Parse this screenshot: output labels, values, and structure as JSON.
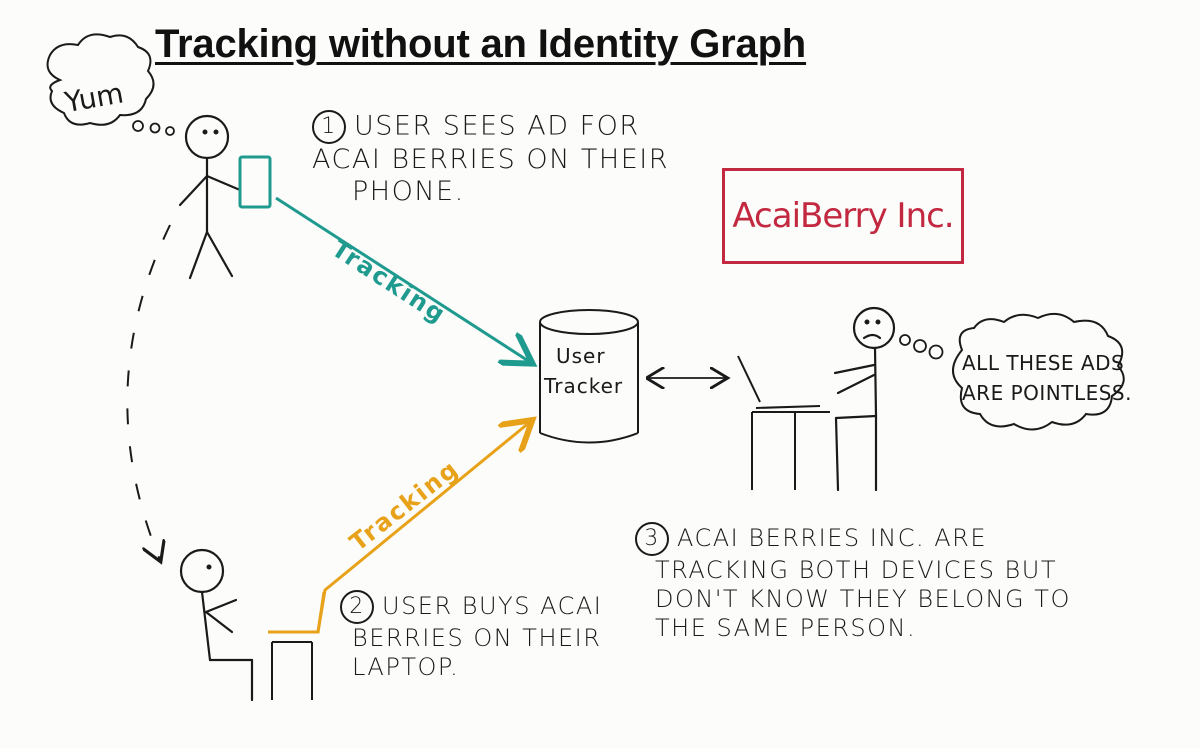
{
  "title": "Tracking without an Identity Graph",
  "thought_yum": "Yum",
  "step1": {
    "number": "1",
    "lines": [
      "User sees ad for",
      "Acai berries on their",
      "phone."
    ]
  },
  "step2": {
    "number": "2",
    "lines": [
      "User buys acai",
      "berries on their",
      "laptop."
    ]
  },
  "step3": {
    "number": "3",
    "lines": [
      "Acai Berries Inc. are",
      "tracking both devices but",
      "don't know they belong to",
      "the same person."
    ]
  },
  "brand": "AcaiBerry Inc.",
  "tracker_label": [
    "User",
    "Tracker"
  ],
  "tracking_top": "Tracking",
  "tracking_bottom": "Tracking",
  "thought_pointless": [
    "All these ads",
    "are pointless."
  ],
  "colors": {
    "teal": "#1f9a8e",
    "orange": "#e8a21a",
    "red": "#c2283f",
    "ink": "#1a1a1a"
  },
  "icons": [
    "phone-icon",
    "laptop-icon",
    "database-cylinder-icon",
    "stick-figure-icon",
    "thought-bubble-icon"
  ]
}
